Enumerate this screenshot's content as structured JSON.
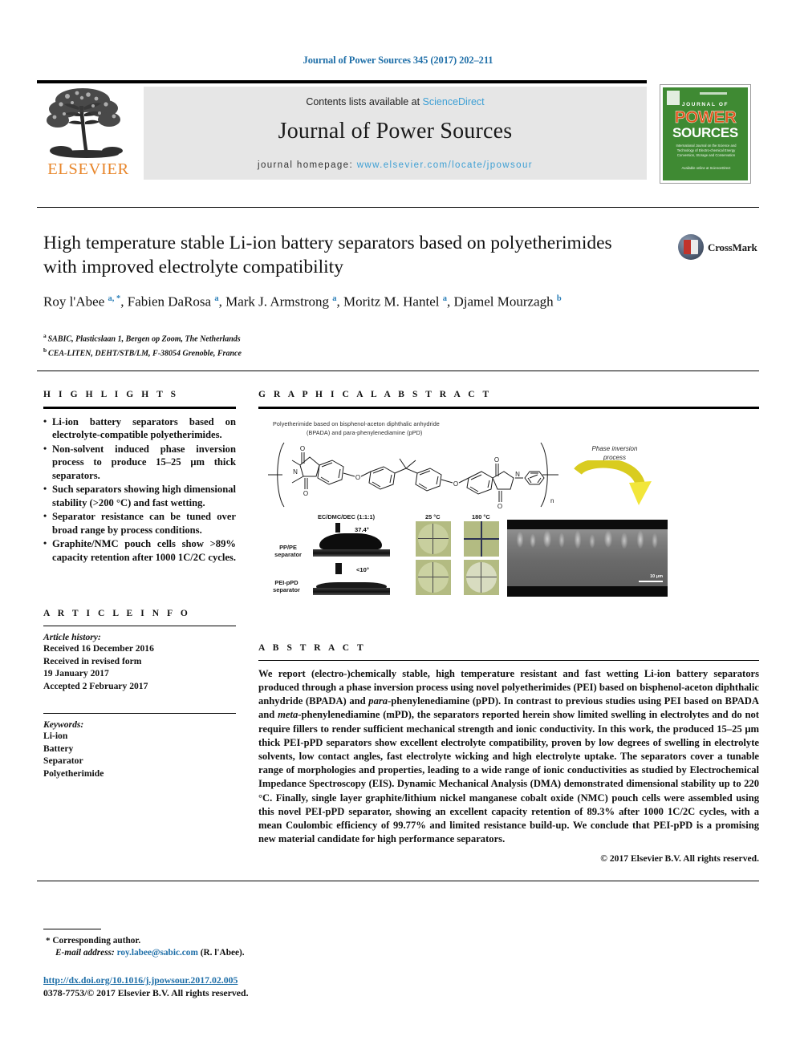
{
  "running_head": "Journal of Power Sources 345 (2017) 202–211",
  "masthead": {
    "contents_prefix": "Contents lists available at ",
    "contents_link": "ScienceDirect",
    "journal_name": "Journal of Power Sources",
    "homepage_prefix": "journal homepage: ",
    "homepage_url": "www.elsevier.com/locate/jpowsour",
    "publisher": "ELSEVIER",
    "cover": {
      "journal_of": "JOURNAL OF",
      "power": "POWER",
      "sources": "SOURCES",
      "subtitle": "International Journal on the Science and Technology of Electro-chemical Energy Conversion, Storage and Conservation",
      "footer": "Available online at\nScienceDirect"
    }
  },
  "article": {
    "title": "High temperature stable Li-ion battery separators based on polyetherimides with improved electrolyte compatibility",
    "authors": [
      {
        "name": "Roy l'Abee",
        "marks": "a, *"
      },
      {
        "name": "Fabien DaRosa",
        "marks": "a"
      },
      {
        "name": "Mark J. Armstrong",
        "marks": "a"
      },
      {
        "name": "Moritz M. Hantel",
        "marks": "a"
      },
      {
        "name": "Djamel Mourzagh",
        "marks": "b"
      }
    ],
    "affiliations": [
      {
        "mark": "a",
        "text": "SABIC, Plasticslaan 1, Bergen op Zoom, The Netherlands"
      },
      {
        "mark": "b",
        "text": "CEA-LITEN, DEHT/STB/LM, F-38054 Grenoble, France"
      }
    ],
    "crossmark_label": "CrossMark"
  },
  "highlights": {
    "heading": "H I G H L I G H T S",
    "items": [
      "Li-ion battery separators based on electrolyte-compatible polyetherimides.",
      "Non-solvent induced phase inversion process to produce 15–25 μm thick separators.",
      "Such separators showing high dimensional stability (>200 °C) and fast wetting.",
      "Separator resistance can be tuned over broad range by process conditions.",
      "Graphite/NMC pouch cells show >89% capacity retention after 1000 1C/2C cycles."
    ]
  },
  "article_info": {
    "heading": "A R T I C L E   I N F O",
    "history_label": "Article history:",
    "history_lines": [
      "Received 16 December 2016",
      "Received in revised form",
      "19 January 2017",
      "Accepted 2 February 2017"
    ],
    "keywords_label": "Keywords:",
    "keywords": [
      "Li-ion",
      "Battery",
      "Separator",
      "Polyetherimide"
    ]
  },
  "graphical_abstract": {
    "heading": "G R A P H I C A L   A B S T R A C T",
    "figure": {
      "caption_line1": "Polyetherimide based on bisphenol-aceton diphthalic anhydride",
      "caption_line2": "(BPADA) and para-phenylenediamine (pPD)",
      "repeat_unit_label": "n",
      "arrow_label_line1": "Phase inversion",
      "arrow_label_line2": "process",
      "arrow_color": "#e0d32a",
      "column_headers": [
        "EC/DMC/DEC (1:1:1)",
        "25 °C",
        "180 °C"
      ],
      "rows": [
        {
          "label_line1": "PP/PE",
          "label_line2": "separator",
          "contact_angle": "37.4°"
        },
        {
          "label_line1": "PEI-pPD",
          "label_line2": "separator",
          "contact_angle": "<10°"
        }
      ],
      "sem_scale_label": "10 μm",
      "swatch_color": "#b3bb82"
    }
  },
  "abstract": {
    "heading": "A B S T R A C T",
    "paragraph_parts": [
      {
        "t": "We report (electro-)chemically stable, high temperature resistant and fast wetting Li-ion battery separators produced through a phase inversion process using novel polyetherimides (PEI) based on bisphenol-aceton diphthalic anhydride (BPADA) and ",
        "i": false
      },
      {
        "t": "para",
        "i": true
      },
      {
        "t": "-phenylenediamine (pPD). In contrast to previous studies using PEI based on BPADA and ",
        "i": false
      },
      {
        "t": "meta",
        "i": true
      },
      {
        "t": "-phenylenediamine (mPD), the separators reported herein show limited swelling in electrolytes and do not require fillers to render sufficient mechanical strength and ionic conductivity. In this work, the produced 15–25 μm thick PEI-pPD separators show excellent electrolyte compatibility, proven by low degrees of swelling in electrolyte solvents, low contact angles, fast electrolyte wicking and high electrolyte uptake. The separators cover a tunable range of morphologies and properties, leading to a wide range of ionic conductivities as studied by Electrochemical Impedance Spectroscopy (EIS). Dynamic Mechanical Analysis (DMA) demonstrated dimensional stability up to 220 °C. Finally, single layer graphite/lithium nickel manganese cobalt oxide (NMC) pouch cells were assembled using this novel PEI-pPD separator, showing an excellent capacity retention of 89.3% after 1000 1C/2C cycles, with a mean Coulombic efficiency of 99.77% and limited resistance build-up. We conclude that PEI-pPD is a promising new material candidate for high performance separators.",
        "i": false
      }
    ],
    "copyright": "© 2017 Elsevier B.V. All rights reserved."
  },
  "footer": {
    "corresponding_star": "*",
    "corresponding_text": "Corresponding author.",
    "email_label": "E-mail address:",
    "email": "roy.labee@sabic.com",
    "email_suffix": "(R. l'Abee).",
    "doi": "http://dx.doi.org/10.1016/j.jpowsour.2017.02.005",
    "issn": "0378-7753/© 2017 Elsevier B.V. All rights reserved."
  },
  "colors": {
    "link_blue": "#1f6fa8",
    "sd_blue": "#3d9fd4",
    "elsevier_orange": "#e8862b",
    "cover_green": "#3f8a33",
    "author_mark_blue": "#2b7fb8"
  }
}
